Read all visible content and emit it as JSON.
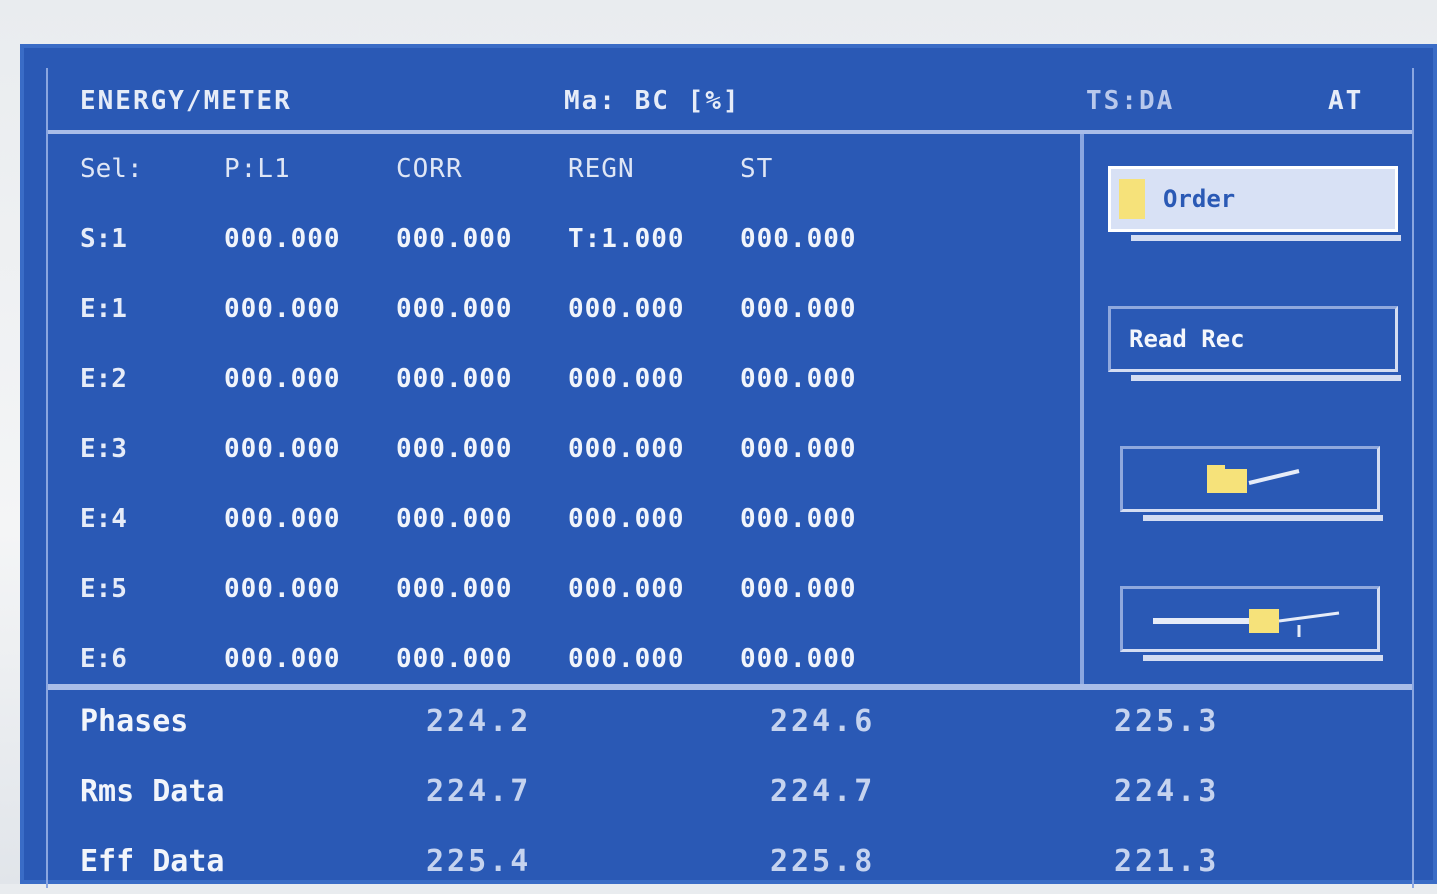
{
  "header": {
    "left": "ENERGY/METER",
    "mid": "Ma: BC [%]",
    "right": "TS:DA",
    "far": "AT"
  },
  "grid": {
    "header_row": {
      "label": "Sel:",
      "cols": [
        "P:L1",
        "CORR",
        "REGN",
        "ST"
      ]
    },
    "rows": [
      {
        "label": "S:1",
        "cols": [
          "000.000",
          "000.000",
          "T:1.000",
          "000.000"
        ]
      },
      {
        "label": "E:1",
        "cols": [
          "000.000",
          "000.000",
          "000.000",
          "000.000"
        ]
      },
      {
        "label": "E:2",
        "cols": [
          "000.000",
          "000.000",
          "000.000",
          "000.000"
        ]
      },
      {
        "label": "E:3",
        "cols": [
          "000.000",
          "000.000",
          "000.000",
          "000.000"
        ]
      },
      {
        "label": "E:4",
        "cols": [
          "000.000",
          "000.000",
          "000.000",
          "000.000"
        ]
      },
      {
        "label": "E:5",
        "cols": [
          "000.000",
          "000.000",
          "000.000",
          "000.000"
        ]
      },
      {
        "label": "E:6",
        "cols": [
          "000.000",
          "000.000",
          "000.000",
          "000.000"
        ]
      }
    ]
  },
  "side_buttons": [
    {
      "label": "Order",
      "active": true
    },
    {
      "label": "Read Rec",
      "active": false
    },
    {
      "label": "",
      "icon": "folder-icon",
      "active": false
    },
    {
      "label": "",
      "icon": "plug-icon",
      "active": false
    }
  ],
  "bottom": [
    {
      "label": "Phases",
      "values": [
        "224.2",
        "224.6",
        "225.3"
      ]
    },
    {
      "label": "Rms Data",
      "values": [
        "224.7",
        "224.7",
        "224.3"
      ]
    },
    {
      "label": "Eff Data",
      "values": [
        "225.4",
        "225.8",
        "221.3"
      ]
    }
  ],
  "colors": {
    "panel": "#2a59b5",
    "highlight": "#f6e27a"
  }
}
